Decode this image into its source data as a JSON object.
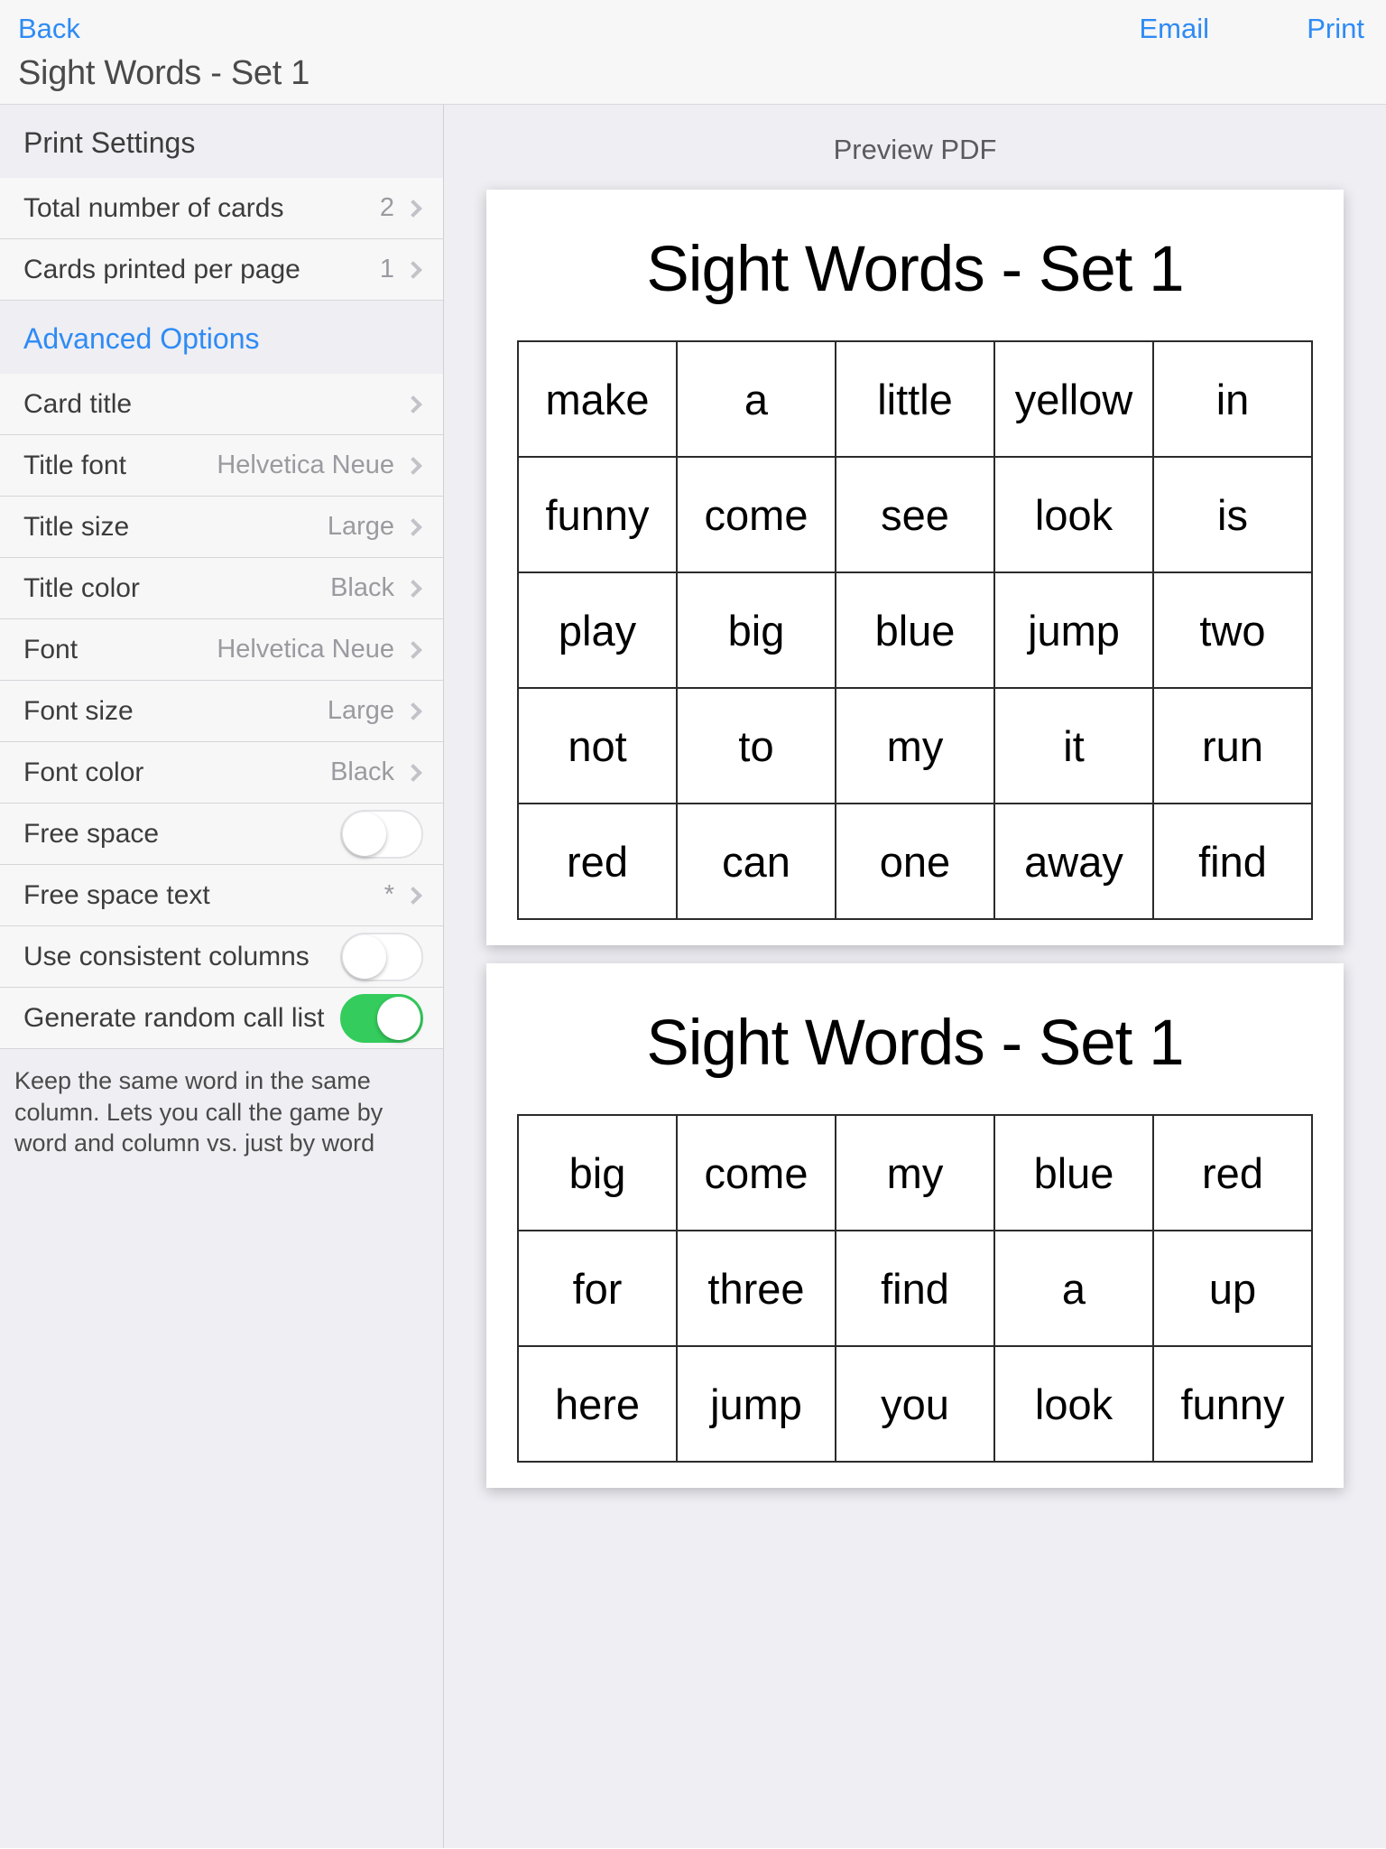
{
  "navbar": {
    "back_label": "Back",
    "email_label": "Email",
    "print_label": "Print",
    "title": "Sight Words - Set 1"
  },
  "sidebar": {
    "print_settings_header": "Print Settings",
    "advanced_options_header": "Advanced Options",
    "rows_basic": [
      {
        "label": "Total number of cards",
        "value": "2"
      },
      {
        "label": "Cards printed per page",
        "value": "1"
      }
    ],
    "rows_advanced": [
      {
        "label": "Card title",
        "value": ""
      },
      {
        "label": "Title font",
        "value": "Helvetica Neue"
      },
      {
        "label": "Title size",
        "value": "Large"
      },
      {
        "label": "Title color",
        "value": "Black"
      },
      {
        "label": "Font",
        "value": "Helvetica Neue"
      },
      {
        "label": "Font size",
        "value": "Large"
      },
      {
        "label": "Font color",
        "value": "Black"
      }
    ],
    "toggle_free_space": {
      "label": "Free space",
      "state": "off"
    },
    "row_free_space_text": {
      "label": "Free space text",
      "value": "*"
    },
    "toggle_consistent_columns": {
      "label": "Use consistent columns",
      "state": "off"
    },
    "toggle_random_call_list": {
      "label": "Generate random call list",
      "state": "on"
    },
    "footnote": "Keep the same word in the same column. Lets you call the game by word and column vs. just by word"
  },
  "preview": {
    "header": "Preview PDF",
    "cards": [
      {
        "title": "Sight Words - Set 1",
        "grid": [
          [
            "make",
            "a",
            "little",
            "yellow",
            "in"
          ],
          [
            "funny",
            "come",
            "see",
            "look",
            "is"
          ],
          [
            "play",
            "big",
            "blue",
            "jump",
            "two"
          ],
          [
            "not",
            "to",
            "my",
            "it",
            "run"
          ],
          [
            "red",
            "can",
            "one",
            "away",
            "find"
          ]
        ]
      },
      {
        "title": "Sight Words - Set 1",
        "grid": [
          [
            "big",
            "come",
            "my",
            "blue",
            "red"
          ],
          [
            "for",
            "three",
            "find",
            "a",
            "up"
          ],
          [
            "here",
            "jump",
            "you",
            "look",
            "funny"
          ]
        ]
      }
    ]
  },
  "colors": {
    "accent": "#2e8bf5",
    "toggle_on": "#34cc5c",
    "panel_bg": "#eeeef3",
    "row_bg": "#f7f7f7"
  }
}
